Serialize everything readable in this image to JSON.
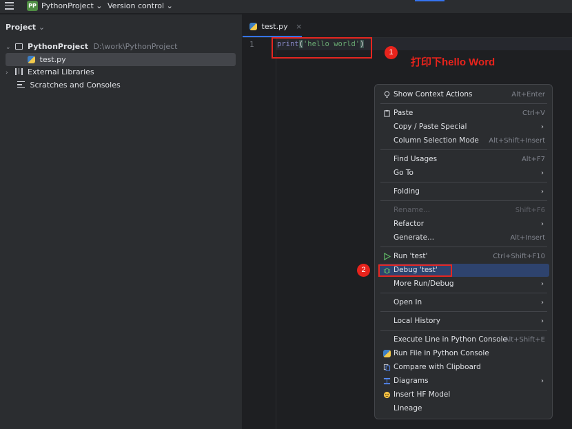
{
  "topbar": {
    "project_badge": "PP",
    "project_name": "PythonProject",
    "project_chevron": "⌄",
    "vcs_label": "Version control",
    "vcs_chevron": "⌄"
  },
  "project_panel": {
    "title": "Project",
    "title_chevron": "⌄",
    "tree": [
      {
        "label": "PythonProject",
        "path": "D:\\work\\PythonProject",
        "chevron": "⌄"
      },
      {
        "label": "test.py"
      },
      {
        "label": "External Libraries",
        "chevron": "›"
      },
      {
        "label": "Scratches and Consoles"
      }
    ]
  },
  "editor": {
    "tab_label": "test.py",
    "tab_close": "×",
    "line_number": "1",
    "code": {
      "fn": "print",
      "open": "(",
      "str": "'hello world'",
      "close": ")"
    }
  },
  "annotations": {
    "badge1": "1",
    "badge2": "2",
    "note": "打印下hello Word"
  },
  "context_menu": {
    "items": [
      {
        "label": "Show Context Actions",
        "shortcut": "Alt+Enter"
      },
      {
        "label": "Paste",
        "shortcut": "Ctrl+V"
      },
      {
        "label": "Copy / Paste Special",
        "arrow": "›"
      },
      {
        "label": "Column Selection Mode",
        "shortcut": "Alt+Shift+Insert"
      },
      {
        "label": "Find Usages",
        "shortcut": "Alt+F7"
      },
      {
        "label": "Go To",
        "arrow": "›"
      },
      {
        "label": "Folding",
        "arrow": "›"
      },
      {
        "label": "Rename...",
        "shortcut": "Shift+F6"
      },
      {
        "label": "Refactor",
        "arrow": "›"
      },
      {
        "label": "Generate...",
        "shortcut": "Alt+Insert"
      },
      {
        "label": "Run 'test'",
        "shortcut": "Ctrl+Shift+F10"
      },
      {
        "label": "Debug 'test'"
      },
      {
        "label": "More Run/Debug",
        "arrow": "›"
      },
      {
        "label": "Open In",
        "arrow": "›"
      },
      {
        "label": "Local History",
        "arrow": "›"
      },
      {
        "label": "Execute Line in Python Console",
        "shortcut": "Alt+Shift+E"
      },
      {
        "label": "Run File in Python Console"
      },
      {
        "label": "Compare with Clipboard"
      },
      {
        "label": "Diagrams",
        "arrow": "›"
      },
      {
        "label": "Insert HF Model"
      },
      {
        "label": "Lineage"
      }
    ]
  }
}
